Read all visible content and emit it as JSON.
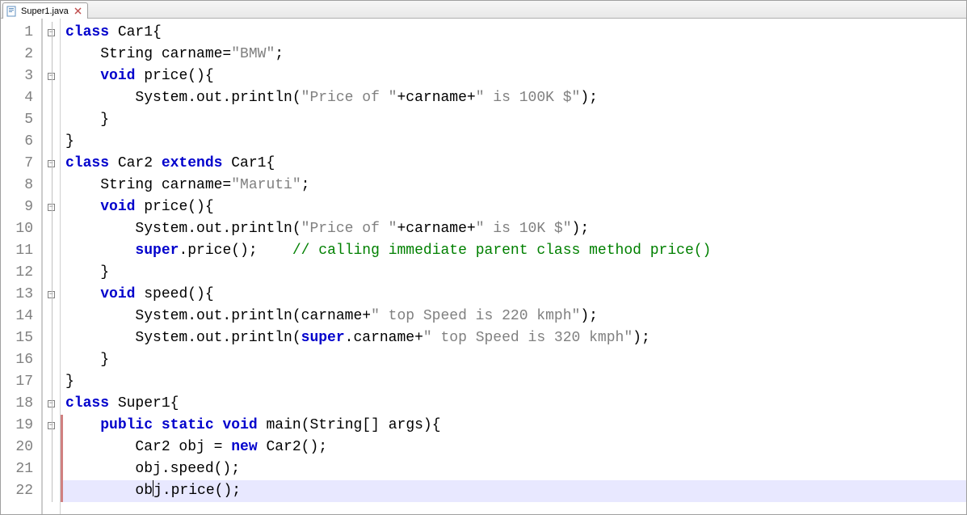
{
  "tab": {
    "filename": "Super1.java",
    "file_icon": "java-file-icon",
    "close_icon": "close-icon"
  },
  "fold_markers": {
    "1": "open",
    "3": "open",
    "7": "open",
    "9": "open",
    "13": "open",
    "18": "open",
    "19": "open"
  },
  "gutter": {
    "start": 1,
    "end": 22
  },
  "highlighted_line": 22,
  "code": {
    "lines": [
      {
        "n": 1,
        "tokens": [
          {
            "t": "kw",
            "v": "class"
          },
          {
            "t": "p",
            "v": " Car1{"
          }
        ]
      },
      {
        "n": 2,
        "tokens": [
          {
            "t": "p",
            "v": "    String carname="
          },
          {
            "t": "str",
            "v": "\"BMW\""
          },
          {
            "t": "p",
            "v": ";"
          }
        ]
      },
      {
        "n": 3,
        "tokens": [
          {
            "t": "p",
            "v": "    "
          },
          {
            "t": "kw",
            "v": "void"
          },
          {
            "t": "p",
            "v": " price(){"
          }
        ]
      },
      {
        "n": 4,
        "tokens": [
          {
            "t": "p",
            "v": "        System.out.println("
          },
          {
            "t": "str",
            "v": "\"Price of \""
          },
          {
            "t": "p",
            "v": "+carname+"
          },
          {
            "t": "str",
            "v": "\" is 100K $\""
          },
          {
            "t": "p",
            "v": ");"
          }
        ]
      },
      {
        "n": 5,
        "tokens": [
          {
            "t": "p",
            "v": "    }"
          }
        ]
      },
      {
        "n": 6,
        "tokens": [
          {
            "t": "p",
            "v": "}"
          }
        ]
      },
      {
        "n": 7,
        "tokens": [
          {
            "t": "kw",
            "v": "class"
          },
          {
            "t": "p",
            "v": " Car2 "
          },
          {
            "t": "kw",
            "v": "extends"
          },
          {
            "t": "p",
            "v": " Car1{"
          }
        ]
      },
      {
        "n": 8,
        "tokens": [
          {
            "t": "p",
            "v": "    String carname="
          },
          {
            "t": "str",
            "v": "\"Maruti\""
          },
          {
            "t": "p",
            "v": ";"
          }
        ]
      },
      {
        "n": 9,
        "tokens": [
          {
            "t": "p",
            "v": "    "
          },
          {
            "t": "kw",
            "v": "void"
          },
          {
            "t": "p",
            "v": " price(){"
          }
        ]
      },
      {
        "n": 10,
        "tokens": [
          {
            "t": "p",
            "v": "        System.out.println("
          },
          {
            "t": "str",
            "v": "\"Price of \""
          },
          {
            "t": "p",
            "v": "+carname+"
          },
          {
            "t": "str",
            "v": "\" is 10K $\""
          },
          {
            "t": "p",
            "v": ");"
          }
        ]
      },
      {
        "n": 11,
        "tokens": [
          {
            "t": "p",
            "v": "        "
          },
          {
            "t": "kw",
            "v": "super"
          },
          {
            "t": "p",
            "v": ".price();    "
          },
          {
            "t": "cmt",
            "v": "// calling immediate parent class method price()"
          }
        ]
      },
      {
        "n": 12,
        "tokens": [
          {
            "t": "p",
            "v": "    }"
          }
        ]
      },
      {
        "n": 13,
        "tokens": [
          {
            "t": "p",
            "v": "    "
          },
          {
            "t": "kw",
            "v": "void"
          },
          {
            "t": "p",
            "v": " speed(){"
          }
        ]
      },
      {
        "n": 14,
        "tokens": [
          {
            "t": "p",
            "v": "        System.out.println(carname+"
          },
          {
            "t": "str",
            "v": "\" top Speed is 220 kmph\""
          },
          {
            "t": "p",
            "v": ");"
          }
        ]
      },
      {
        "n": 15,
        "tokens": [
          {
            "t": "p",
            "v": "        System.out.println("
          },
          {
            "t": "kw",
            "v": "super"
          },
          {
            "t": "p",
            "v": ".carname+"
          },
          {
            "t": "str",
            "v": "\" top Speed is 320 kmph\""
          },
          {
            "t": "p",
            "v": ");"
          }
        ]
      },
      {
        "n": 16,
        "tokens": [
          {
            "t": "p",
            "v": "    }"
          }
        ]
      },
      {
        "n": 17,
        "tokens": [
          {
            "t": "p",
            "v": "}"
          }
        ]
      },
      {
        "n": 18,
        "tokens": [
          {
            "t": "kw",
            "v": "class"
          },
          {
            "t": "p",
            "v": " Super1{"
          }
        ]
      },
      {
        "n": 19,
        "tokens": [
          {
            "t": "p",
            "v": "    "
          },
          {
            "t": "kw",
            "v": "public"
          },
          {
            "t": "p",
            "v": " "
          },
          {
            "t": "kw",
            "v": "static"
          },
          {
            "t": "p",
            "v": " "
          },
          {
            "t": "kw",
            "v": "void"
          },
          {
            "t": "p",
            "v": " main(String[] args){"
          }
        ]
      },
      {
        "n": 20,
        "tokens": [
          {
            "t": "p",
            "v": "        Car2 obj = "
          },
          {
            "t": "kw",
            "v": "new"
          },
          {
            "t": "p",
            "v": " Car2();"
          }
        ]
      },
      {
        "n": 21,
        "tokens": [
          {
            "t": "p",
            "v": "        obj.speed();"
          }
        ]
      },
      {
        "n": 22,
        "tokens": [
          {
            "t": "p",
            "v": "        ob"
          },
          {
            "t": "caret",
            "v": ""
          },
          {
            "t": "p",
            "v": "j.price();"
          }
        ]
      }
    ]
  },
  "change_bar": {
    "from_line": 19,
    "to_line": 22
  }
}
